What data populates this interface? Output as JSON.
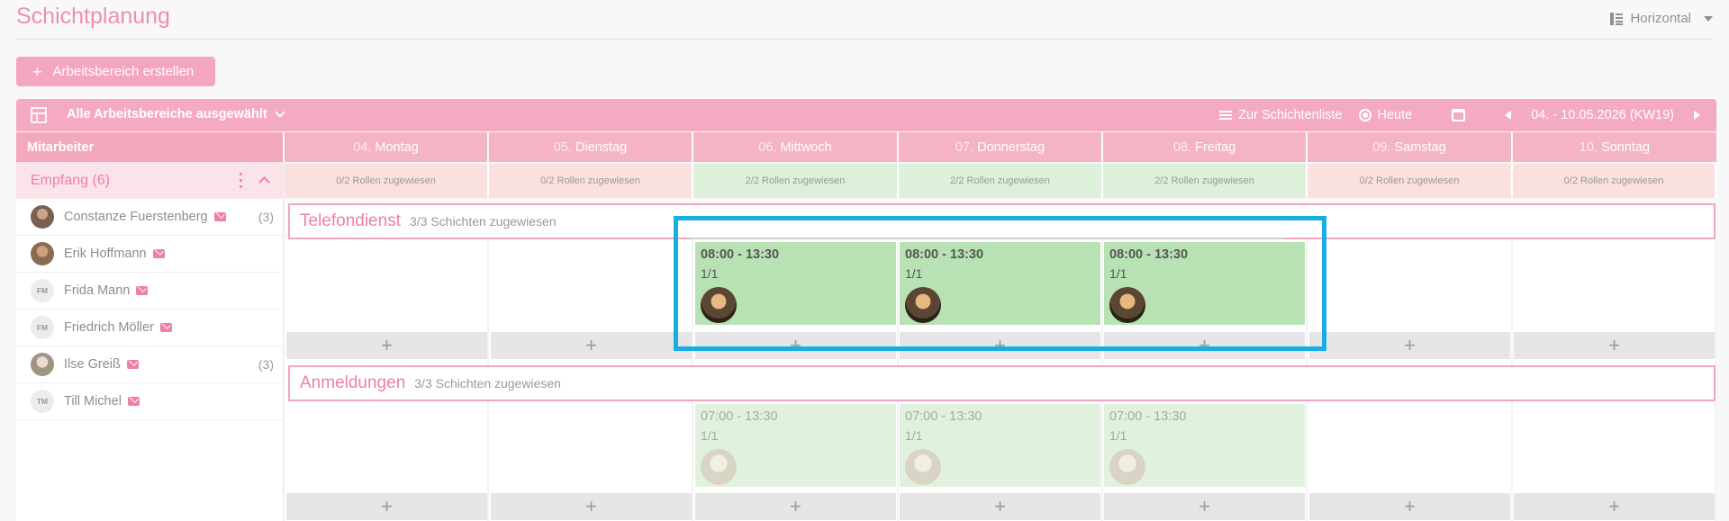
{
  "page": {
    "title": "Schichtplanung",
    "view_mode": "Horizontal"
  },
  "actions": {
    "create_area": "Arbeitsbereich erstellen"
  },
  "toolbar": {
    "areas_filter": "Alle Arbeitsbereiche ausgewählt",
    "shift_list": "Zur Schichtenliste",
    "today": "Heute",
    "week_range": "04. - 10.05.2026 (KW19)"
  },
  "columns": {
    "employee": "Mitarbeiter",
    "days": [
      {
        "num": "04.",
        "name": "Montag"
      },
      {
        "num": "05.",
        "name": "Dienstag"
      },
      {
        "num": "06.",
        "name": "Mittwoch"
      },
      {
        "num": "07.",
        "name": "Donnerstag"
      },
      {
        "num": "08.",
        "name": "Freitag"
      },
      {
        "num": "09.",
        "name": "Samstag"
      },
      {
        "num": "10.",
        "name": "Sonntag"
      }
    ]
  },
  "group": {
    "name": "Empfang (6)"
  },
  "employees": [
    {
      "name": "Constanze Fuerstenberg",
      "initials": "",
      "count": "(3)"
    },
    {
      "name": "Erik Hoffmann",
      "initials": "",
      "count": ""
    },
    {
      "name": "Frida Mann",
      "initials": "FM",
      "count": ""
    },
    {
      "name": "Friedrich Möller",
      "initials": "FM",
      "count": ""
    },
    {
      "name": "Ilse Greiß",
      "initials": "",
      "count": "(3)"
    },
    {
      "name": "Till Michel",
      "initials": "TM",
      "count": ""
    }
  ],
  "roles": [
    "0/2 Rollen zugewiesen",
    "0/2 Rollen zugewiesen",
    "2/2 Rollen zugewiesen",
    "2/2 Rollen zugewiesen",
    "2/2 Rollen zugewiesen",
    "0/2 Rollen zugewiesen",
    "0/2 Rollen zugewiesen"
  ],
  "areas": [
    {
      "title": "Telefondienst",
      "summary": "3/3 Schichten zugewiesen",
      "shifts": [
        {
          "time": "08:00 - 13:30",
          "ratio": "1/1"
        },
        {
          "time": "08:00 - 13:30",
          "ratio": "1/1"
        },
        {
          "time": "08:00 - 13:30",
          "ratio": "1/1"
        }
      ]
    },
    {
      "title": "Anmeldungen",
      "summary": "3/3 Schichten zugewiesen",
      "shifts": [
        {
          "time": "07:00 - 13:30",
          "ratio": "1/1"
        },
        {
          "time": "07:00 - 13:30",
          "ratio": "1/1"
        },
        {
          "time": "07:00 - 13:30",
          "ratio": "1/1"
        }
      ]
    }
  ],
  "add_symbol": "+"
}
